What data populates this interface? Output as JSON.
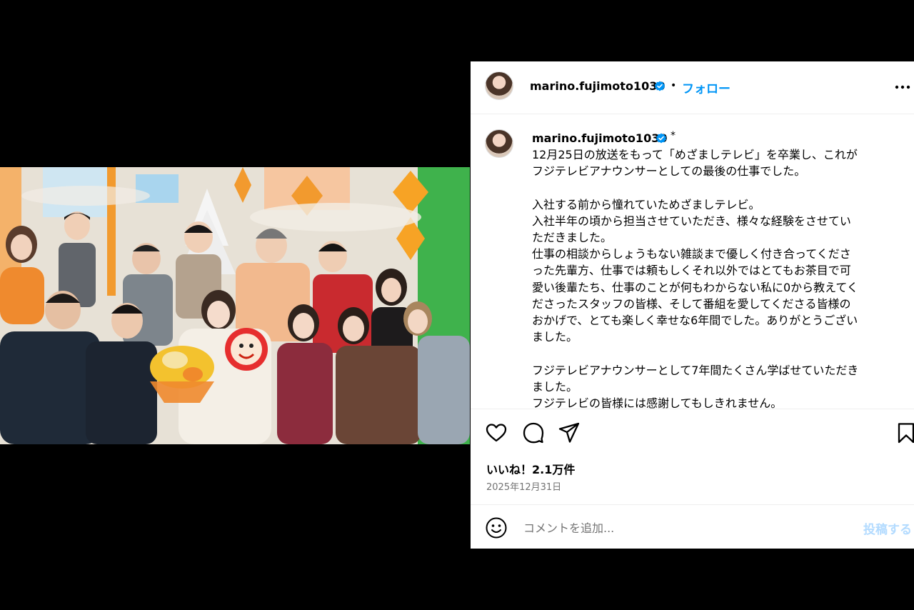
{
  "post": {
    "username": "marino.fujimoto1030",
    "follow_label": "フォロー",
    "separator": "•",
    "edited_mark": "*",
    "caption_lines": [
      "12月25日の放送をもって「めざましテレビ」を卒業し、これが",
      "フジテレビアナウンサーとしての最後の仕事でした。",
      "",
      "入社する前から憧れていためざましテレビ。",
      "入社半年の頃から担当させていただき、様々な経験をさせてい",
      "ただきました。",
      "仕事の相談からしょうもない雑談まで優しく付き合ってくださ",
      "った先輩方、仕事では頼もしくそれ以外ではとてもお茶目で可",
      "愛い後輩たち、仕事のことが何もわからない私に0から教えてく",
      "ださったスタッフの皆様、そして番組を愛してくださる皆様の",
      "おかげで、とても楽しく幸せな6年間でした。ありがとうござい",
      "ました。",
      "",
      "フジテレビアナウンサーとして7年間たくさん学ばせていただき",
      "ました。",
      "フジテレビの皆様には感謝してもしきれません。"
    ],
    "likes_text": "いいね！2.1万件",
    "date_text": "2025年12月31日",
    "comment_placeholder": "コメントを追加...",
    "post_button_label": "投稿する"
  },
  "icons": {
    "verified": "verified-badge-icon",
    "more": "more-options-icon",
    "like": "heart-icon",
    "comment": "comment-icon",
    "share": "share-icon",
    "save": "bookmark-icon",
    "emoji": "emoji-icon"
  },
  "colors": {
    "accent": "#0095f6",
    "post_disabled": "#b3dbff",
    "muted": "#737373"
  }
}
